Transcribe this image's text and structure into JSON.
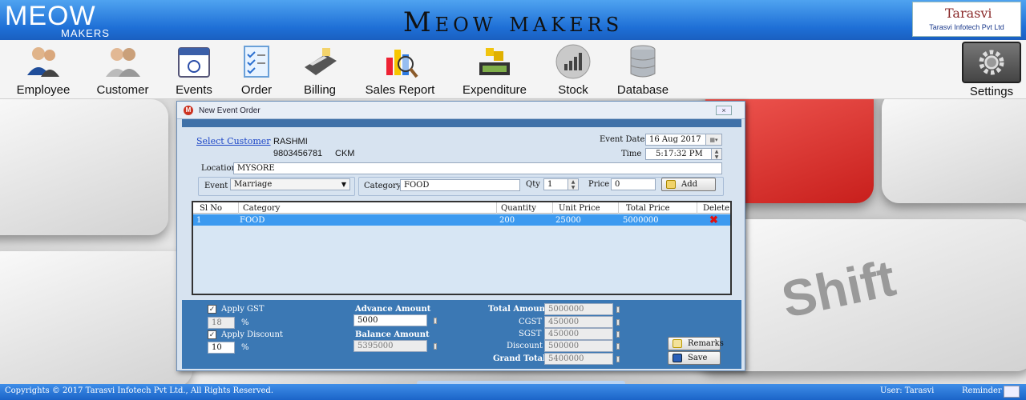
{
  "header": {
    "logo_main": "MEOW",
    "logo_sub": "MAKERS",
    "app_title": "Meow makers",
    "brand_mark": "Tarasvi",
    "brand_name": "Tarasvi Infotech Pvt Ltd"
  },
  "toolbar": {
    "items": [
      {
        "label": "Employee",
        "icon": "employee-icon"
      },
      {
        "label": "Customer",
        "icon": "customer-icon"
      },
      {
        "label": "Events",
        "icon": "calendar-icon"
      },
      {
        "label": "Order",
        "icon": "order-icon"
      },
      {
        "label": "Billing",
        "icon": "billing-icon"
      },
      {
        "label": "Sales Report",
        "icon": "sales-report-icon"
      },
      {
        "label": "Expenditure",
        "icon": "expenditure-icon"
      },
      {
        "label": "Stock",
        "icon": "stock-icon"
      },
      {
        "label": "Database",
        "icon": "database-icon"
      }
    ],
    "settings_label": "Settings"
  },
  "background": {
    "key_text_1": "Shift"
  },
  "dialog": {
    "title": "New Event Order",
    "select_customer": "Select Customer",
    "customer_name": "RASHMI",
    "customer_phone": "9803456781",
    "customer_code": "CKM",
    "event_date_label": "Event Date",
    "event_date_value": "16 Aug 2017",
    "time_label": "Time",
    "time_value": "5:17:32 PM",
    "location_label": "Location",
    "location_value": "MYSORE",
    "event_label": "Event",
    "event_value": "Marriage",
    "category_label": "Category",
    "category_value": "FOOD",
    "qty_label": "Qty",
    "qty_value": "1",
    "price_label": "Price",
    "price_value": "0",
    "add_button": "Add",
    "grid": {
      "columns": [
        "Sl No",
        "Category",
        "Quantity",
        "Unit Price",
        "Total Price",
        "Delete"
      ],
      "rows": [
        {
          "sl": "1",
          "category": "FOOD",
          "quantity": "200",
          "unit_price": "25000",
          "total_price": "5000000"
        }
      ]
    },
    "apply_gst_label": "Apply GST",
    "gst_value": "18",
    "percent": "%",
    "apply_discount_label": "Apply Discount",
    "discount_value": "10",
    "advance_amount_label": "Advance Amount",
    "advance_amount_value": "5000",
    "balance_amount_label": "Balance Amount",
    "balance_amount_value": "5395000",
    "total_amount_label": "Total Amount",
    "total_amount_value": "5000000",
    "cgst_label": "CGST",
    "cgst_value": "450000",
    "sgst_label": "SGST",
    "sgst_value": "450000",
    "discount_label": "Discount",
    "discount_amount_value": "500000",
    "grand_total_label": "Grand Total",
    "grand_total_value": "5400000",
    "remarks_button": "Remarks",
    "save_button": "Save"
  },
  "footer": {
    "copyright": "Copyrights © 2017 Tarasvi Infotech Pvt Ltd., All Rights Reserved.",
    "user": "User: Tarasvi",
    "reminder": "Reminder"
  },
  "colors": {
    "header_blue": "#1e6fd6",
    "panel_blue": "#3b78b4",
    "selected_row": "#3c9af0"
  }
}
